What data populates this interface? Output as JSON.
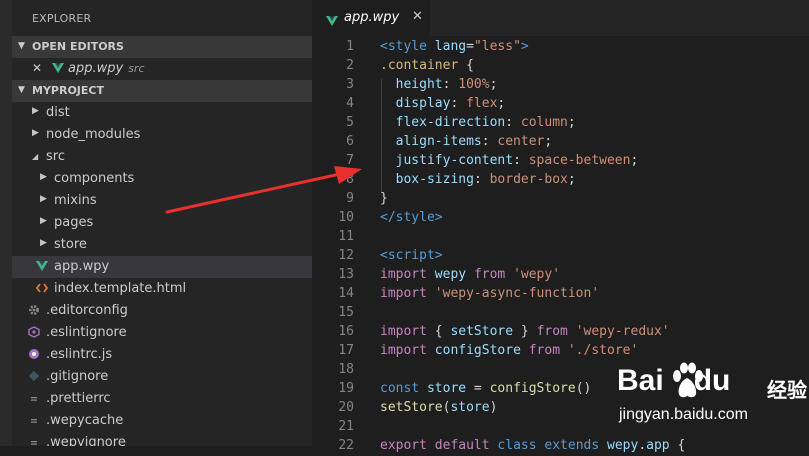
{
  "explorer": {
    "title": "EXPLORER",
    "open_editors": {
      "header": "OPEN EDITORS",
      "items": [
        {
          "close_glyph": "✕",
          "name": "app.wpy",
          "folder": "src"
        }
      ]
    },
    "project": {
      "header": "MYPROJECT",
      "tree": [
        {
          "label": "dist",
          "indent": 1,
          "chevron": "right",
          "icon": "folder-icon"
        },
        {
          "label": "node_modules",
          "indent": 1,
          "chevron": "right",
          "icon": "folder-icon"
        },
        {
          "label": "src",
          "indent": 1,
          "chevron": "down",
          "icon": "folder-open-icon"
        },
        {
          "label": "components",
          "indent": 2,
          "chevron": "right",
          "icon": "folder-icon"
        },
        {
          "label": "mixins",
          "indent": 2,
          "chevron": "right",
          "icon": "folder-icon"
        },
        {
          "label": "pages",
          "indent": 2,
          "chevron": "right",
          "icon": "folder-icon"
        },
        {
          "label": "store",
          "indent": 2,
          "chevron": "right",
          "icon": "folder-icon"
        },
        {
          "label": "app.wpy",
          "indent": 2,
          "icon": "vue-icon",
          "selected": true
        },
        {
          "label": "index.template.html",
          "indent": 2,
          "icon": "html-icon"
        },
        {
          "label": ".editorconfig",
          "indent": 1,
          "icon": "gear-icon"
        },
        {
          "label": ".eslintignore",
          "indent": 1,
          "icon": "eslint-icon"
        },
        {
          "label": ".eslintrc.js",
          "indent": 1,
          "icon": "eslint-circle-icon"
        },
        {
          "label": ".gitignore",
          "indent": 1,
          "icon": "git-icon"
        },
        {
          "label": ".prettierrc",
          "indent": 1,
          "icon": "file-icon"
        },
        {
          "label": ".wepycache",
          "indent": 1,
          "icon": "file-icon"
        },
        {
          "label": ".wepyignore",
          "indent": 1,
          "icon": "file-icon"
        }
      ]
    }
  },
  "tab": {
    "label": "app.wpy",
    "close_glyph": "✕"
  },
  "colors": {
    "vue_green": "#41b883",
    "arrow_red": "#e8302c",
    "html_orange": "#e37933",
    "eslint_purple": "#a074c4"
  },
  "code_lines": [
    [
      [
        "<",
        "k-tag"
      ],
      [
        "style",
        "k-tag"
      ],
      [
        " ",
        "k-pun"
      ],
      [
        "lang",
        "k-attr"
      ],
      [
        "=",
        "k-pun"
      ],
      [
        "\"less\"",
        "k-str"
      ],
      [
        ">",
        "k-tag"
      ]
    ],
    [
      [
        ".container",
        "k-sel"
      ],
      [
        " {",
        "k-pun"
      ]
    ],
    [
      [
        "  ",
        "k-pun"
      ],
      [
        "height",
        "k-prop"
      ],
      [
        ": ",
        "k-pun"
      ],
      [
        "100%",
        "k-val"
      ],
      [
        ";",
        "k-pun"
      ]
    ],
    [
      [
        "  ",
        "k-pun"
      ],
      [
        "display",
        "k-prop"
      ],
      [
        ": ",
        "k-pun"
      ],
      [
        "flex",
        "k-val"
      ],
      [
        ";",
        "k-pun"
      ]
    ],
    [
      [
        "  ",
        "k-pun"
      ],
      [
        "flex-direction",
        "k-prop"
      ],
      [
        ": ",
        "k-pun"
      ],
      [
        "column",
        "k-val"
      ],
      [
        ";",
        "k-pun"
      ]
    ],
    [
      [
        "  ",
        "k-pun"
      ],
      [
        "align-items",
        "k-prop"
      ],
      [
        ": ",
        "k-pun"
      ],
      [
        "center",
        "k-val"
      ],
      [
        ";",
        "k-pun"
      ]
    ],
    [
      [
        "  ",
        "k-pun"
      ],
      [
        "justify-content",
        "k-prop"
      ],
      [
        ": ",
        "k-pun"
      ],
      [
        "space-between",
        "k-val"
      ],
      [
        ";",
        "k-pun"
      ]
    ],
    [
      [
        "  ",
        "k-pun"
      ],
      [
        "box-sizing",
        "k-prop"
      ],
      [
        ": ",
        "k-pun"
      ],
      [
        "border-box",
        "k-val"
      ],
      [
        ";",
        "k-pun"
      ]
    ],
    [
      [
        "}",
        "k-pun"
      ]
    ],
    [
      [
        "</",
        "k-tag"
      ],
      [
        "style",
        "k-tag"
      ],
      [
        ">",
        "k-tag"
      ]
    ],
    [],
    [
      [
        "<",
        "k-tag"
      ],
      [
        "script",
        "k-tag"
      ],
      [
        ">",
        "k-tag"
      ]
    ],
    [
      [
        "import",
        "k-kw"
      ],
      [
        " ",
        "k-pun"
      ],
      [
        "wepy",
        "k-var"
      ],
      [
        " ",
        "k-pun"
      ],
      [
        "from",
        "k-kw"
      ],
      [
        " ",
        "k-pun"
      ],
      [
        "'wepy'",
        "k-str"
      ]
    ],
    [
      [
        "import",
        "k-kw"
      ],
      [
        " ",
        "k-pun"
      ],
      [
        "'wepy-async-function'",
        "k-str"
      ]
    ],
    [],
    [
      [
        "import",
        "k-kw"
      ],
      [
        " { ",
        "k-pun"
      ],
      [
        "setStore",
        "k-var"
      ],
      [
        " } ",
        "k-pun"
      ],
      [
        "from",
        "k-kw"
      ],
      [
        " ",
        "k-pun"
      ],
      [
        "'wepy-redux'",
        "k-str"
      ]
    ],
    [
      [
        "import",
        "k-kw"
      ],
      [
        " ",
        "k-pun"
      ],
      [
        "configStore",
        "k-var"
      ],
      [
        " ",
        "k-pun"
      ],
      [
        "from",
        "k-kw"
      ],
      [
        " ",
        "k-pun"
      ],
      [
        "'./store'",
        "k-str"
      ]
    ],
    [],
    [
      [
        "const",
        "k-store"
      ],
      [
        " ",
        "k-pun"
      ],
      [
        "store",
        "k-var"
      ],
      [
        " = ",
        "k-pun"
      ],
      [
        "configStore",
        "k-fn"
      ],
      [
        "()",
        "k-pun"
      ]
    ],
    [
      [
        "setStore",
        "k-fn"
      ],
      [
        "(",
        "k-pun"
      ],
      [
        "store",
        "k-var"
      ],
      [
        ")",
        "k-pun"
      ]
    ],
    [],
    [
      [
        "export",
        "k-kw"
      ],
      [
        " ",
        "k-pun"
      ],
      [
        "default",
        "k-kw"
      ],
      [
        " ",
        "k-pun"
      ],
      [
        "class",
        "k-store"
      ],
      [
        " ",
        "k-pun"
      ],
      [
        "extends",
        "k-store"
      ],
      [
        " ",
        "k-pun"
      ],
      [
        "wepy",
        "k-var"
      ],
      [
        ".",
        "k-pun"
      ],
      [
        "app",
        "k-var"
      ],
      [
        " {",
        "k-pun"
      ]
    ]
  ],
  "watermark": {
    "brand": "Bai",
    "brand2": "du",
    "product": "经验",
    "url": "jingyan.baidu.com"
  }
}
